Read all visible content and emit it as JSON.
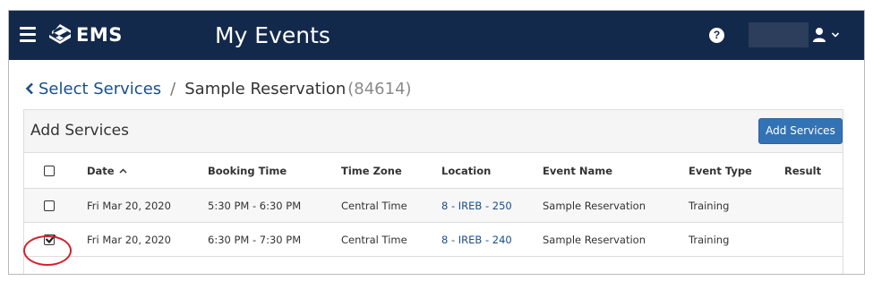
{
  "header": {
    "logo_text": "EMS",
    "app_title": "My Events",
    "help_glyph": "?",
    "icons": [
      "menu-icon",
      "ems-logo-icon",
      "help-icon",
      "user-icon",
      "chevron-down-icon"
    ],
    "bar_color": "#13294b"
  },
  "breadcrumb": {
    "back_label": "Select Services",
    "separator": "/",
    "current": "Sample Reservation",
    "reservation_id": "(84614)"
  },
  "panel": {
    "title": "Add Services",
    "add_button_label": "Add Services",
    "accent": "#3273b5"
  },
  "table": {
    "columns": [
      "Date",
      "Booking Time",
      "Time Zone",
      "Location",
      "Event Name",
      "Event Type",
      "Result"
    ],
    "sort_column": "Date",
    "rows": [
      {
        "checked": false,
        "date": "Fri Mar 20, 2020",
        "booking_time": "5:30 PM - 6:30 PM",
        "time_zone": "Central Time",
        "location": "8 - IREB - 250",
        "event_name": "Sample Reservation",
        "event_type": "Training",
        "result": ""
      },
      {
        "checked": true,
        "date": "Fri Mar 20, 2020",
        "booking_time": "6:30 PM - 7:30 PM",
        "time_zone": "Central Time",
        "location": "8 - IREB - 240",
        "event_name": "Sample Reservation",
        "event_type": "Training",
        "result": ""
      }
    ]
  },
  "annotation_color": "#d4202c"
}
